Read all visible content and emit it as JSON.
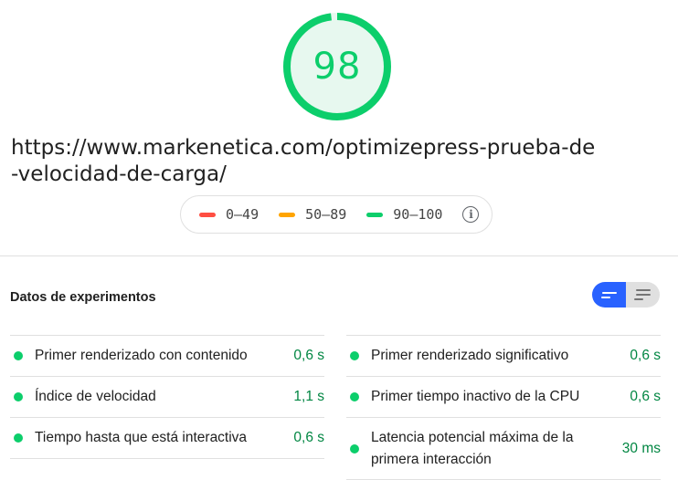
{
  "score": {
    "value": "98",
    "fraction": 0.98,
    "color": "#0cce6b",
    "fill": "#e7f8ef"
  },
  "url": "https://www.markenetica.com/optimizepress-prueba-de-velocidad-de-carga/",
  "legend": {
    "fail": {
      "label": "0–49",
      "color": "#ff4e42"
    },
    "average": {
      "label": "50–89",
      "color": "#ffa400"
    },
    "pass": {
      "label": "90–100",
      "color": "#0cce6b"
    },
    "info_icon": "info-icon"
  },
  "section": {
    "title": "Datos de experimentos",
    "toggle_active_icon": "list-compact-icon",
    "toggle_inactive_icon": "list-expanded-icon"
  },
  "metrics_left": [
    {
      "label": "Primer renderizado con contenido",
      "value": "0,6 s"
    },
    {
      "label": "Índice de velocidad",
      "value": "1,1 s"
    },
    {
      "label": "Tiempo hasta que está interactiva",
      "value": "0,6 s"
    }
  ],
  "metrics_right": [
    {
      "label": "Primer renderizado significativo",
      "value": "0,6 s"
    },
    {
      "label": "Primer tiempo inactivo de la CPU",
      "value": "0,6 s"
    },
    {
      "label": "Latencia potencial máxima de la primera interacción",
      "value": "30 ms"
    }
  ]
}
